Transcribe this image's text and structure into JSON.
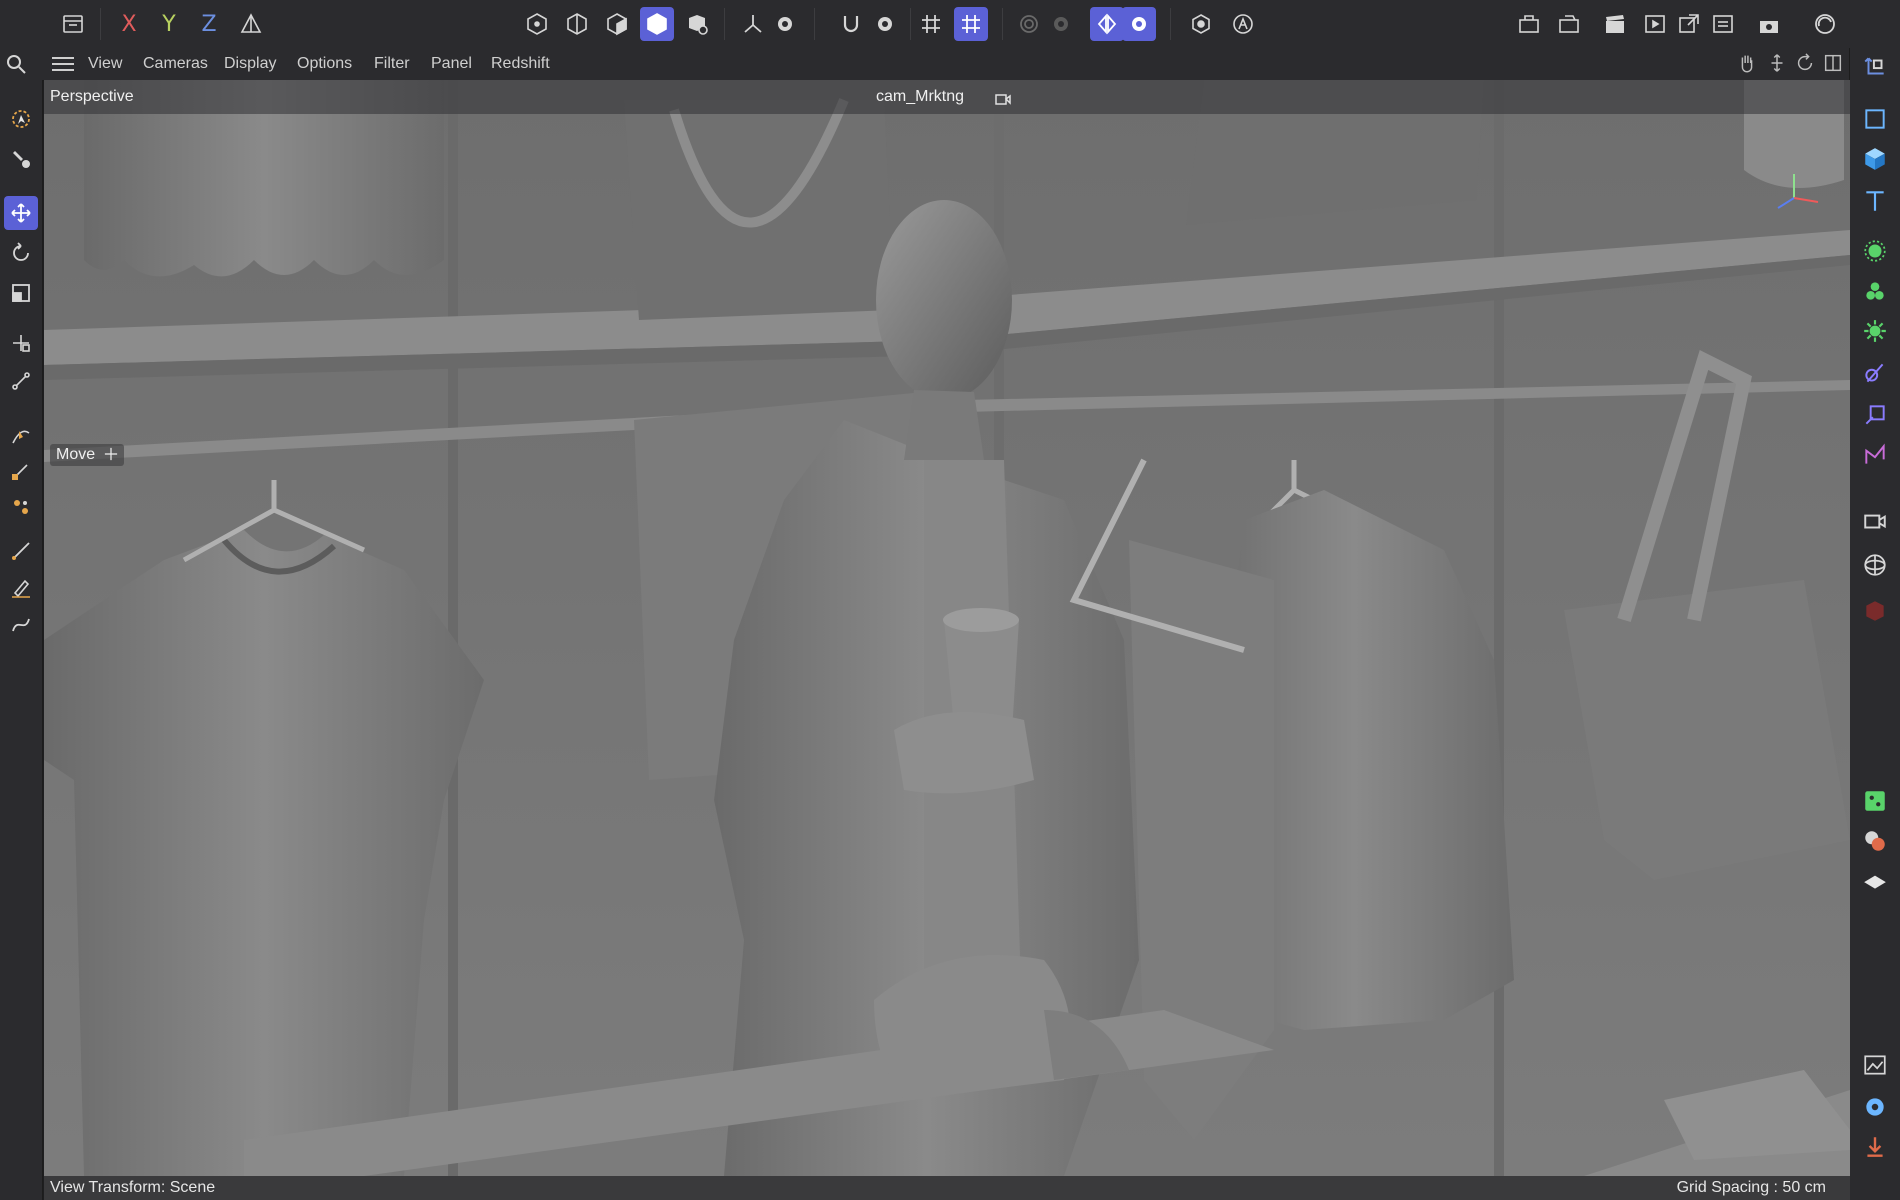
{
  "toolbar": {
    "axis_x": "X",
    "axis_y": "Y",
    "axis_z": "Z",
    "icons": [
      "undo-panel-icon",
      "axis-x-toggle",
      "axis-y-toggle",
      "axis-z-toggle",
      "coordinate-system-icon",
      "points-mode-icon",
      "edges-mode-icon",
      "polygons-mode-icon",
      "model-mode-icon",
      "texture-mode-icon",
      "snap-axis-icon",
      "settings-icon",
      "magnet-icon",
      "settings-icon",
      "grid-snap-icon",
      "workplane-snap-icon",
      "soft-selection-icon",
      "settings-icon",
      "symmetry-icon",
      "settings-icon",
      "viewport-solo-icon",
      "auto-icon",
      "render-region-icon",
      "render-view-icon",
      "clapper-icon",
      "render-to-viewer-icon",
      "render-to-picture-viewer-icon",
      "render-queue-icon",
      "render-settings-icon",
      "redshift-icon"
    ]
  },
  "menu": {
    "items": [
      "View",
      "Cameras",
      "Display",
      "Options",
      "Filter",
      "Panel",
      "Redshift"
    ]
  },
  "viewport": {
    "view_name": "Perspective",
    "camera_name": "cam_Mrktng",
    "active_tool": "Move",
    "status_left": "View Transform: Scene",
    "status_right": "Grid Spacing : 50 cm"
  },
  "colors": {
    "accent": "#5b61d6",
    "panel": "#2b2b2e",
    "viewport_bg": "#747474",
    "axis_x": "#e05c5c",
    "axis_y": "#b8d160",
    "axis_z": "#6c8fe0"
  }
}
